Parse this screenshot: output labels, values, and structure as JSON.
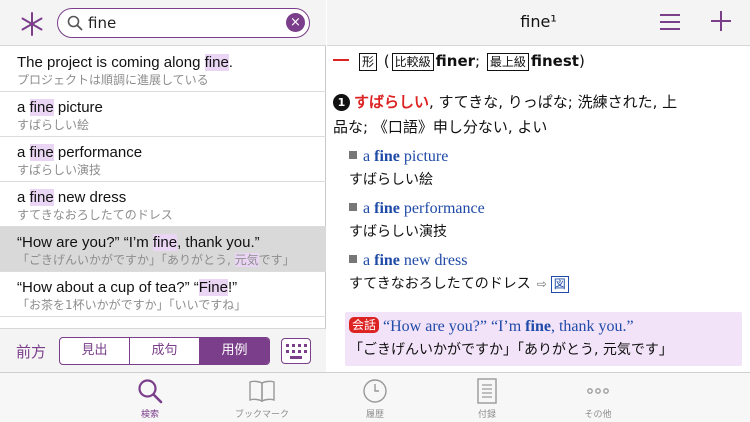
{
  "search": {
    "value": "fine",
    "clear_symbol": "×"
  },
  "results": [
    {
      "en_pre": "The project is coming along ",
      "en_hl": "fine",
      "en_post": ".",
      "ja": "プロジェクトは順調に進展している"
    },
    {
      "en_pre": "a ",
      "en_hl": "fine",
      "en_post": " picture",
      "ja": "すばらしい絵"
    },
    {
      "en_pre": "a ",
      "en_hl": "fine",
      "en_post": " performance",
      "ja": "すばらしい演技"
    },
    {
      "en_pre": "a ",
      "en_hl": "fine",
      "en_post": " new dress",
      "ja": "すてきなおろしたてのドレス"
    },
    {
      "en_pre": "“How are you?” “I’m ",
      "en_hl": "fine",
      "en_post": ", thank you.”",
      "ja_pre": "「ごきげんいかがですか」「ありがとう, ",
      "ja_hl": "元気",
      "ja_post": "です」",
      "selected": true
    },
    {
      "en_pre": "“How about a cup of tea?” “",
      "en_hl": "Fine",
      "en_post": "!”",
      "ja": "「お茶を1杯いかがですか」「いいですね」"
    }
  ],
  "bottom_left": {
    "direction_label": "前方",
    "segments": [
      {
        "label": "見出",
        "active": false
      },
      {
        "label": "成句",
        "active": false
      },
      {
        "label": "用例",
        "active": true
      }
    ]
  },
  "entry": {
    "title": "fine¹",
    "pos": "形",
    "comparative_label": "比較級",
    "comparative": "finer",
    "superlative_label": "最上級",
    "superlative": "finest",
    "sense_number": "1",
    "sense_main": "すばらしい",
    "sense_rest_1": ", すてきな, りっぱな; 洗練された, 上",
    "sense_rest_2": "品な; 《口語》申し分ない, よい",
    "examples": [
      {
        "pre": "a ",
        "head": "fine",
        "post": " picture",
        "ja": "すばらしい絵"
      },
      {
        "pre": "a ",
        "head": "fine",
        "post": " performance",
        "ja": "すばらしい演技"
      },
      {
        "pre": "a ",
        "head": "fine",
        "post": " new dress",
        "ja": "すてきなおろしたてのドレス",
        "fig": "図"
      }
    ],
    "conversation": {
      "tag": "会話",
      "en_pre": "“How are you?” “I’m ",
      "en_head": "fine",
      "en_post": ", thank you.”",
      "ja": "「ごきげんいかがですか」「ありがとう, 元気です」"
    }
  },
  "tabs": [
    {
      "label": "検索",
      "icon": "search-icon",
      "active": true
    },
    {
      "label": "ブックマーク",
      "icon": "book-icon",
      "active": false
    },
    {
      "label": "履歴",
      "icon": "clock-icon",
      "active": false
    },
    {
      "label": "付録",
      "icon": "document-icon",
      "active": false
    },
    {
      "label": "その他",
      "icon": "more-icon",
      "active": false
    }
  ],
  "colors": {
    "accent": "#7a3e8a",
    "red": "#dd2222",
    "link_blue": "#1f4aa8",
    "highlight": "#ead6f4"
  }
}
